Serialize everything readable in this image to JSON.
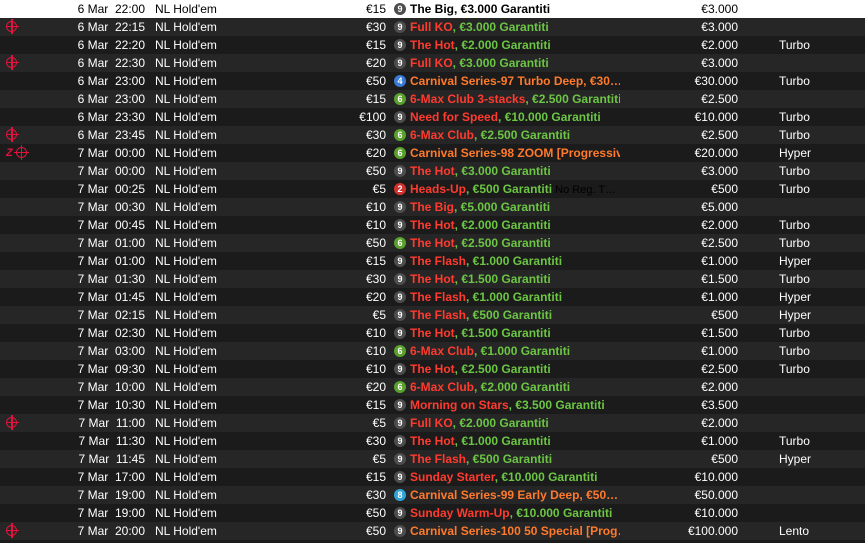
{
  "colors": {
    "name_red": "#ff3b2f",
    "name_green": "#6cc644",
    "name_orange": "#ff7a2c",
    "icon_red": "#e0143c",
    "row_odd": "#262626",
    "row_even": "#1b1b1b",
    "selected_bg": "#ffffff"
  },
  "rows": [
    {
      "icons": [],
      "date": "6 Mar",
      "time": "22:00",
      "game": "NL Hold'em",
      "buyin": "€15",
      "seats": "9",
      "badge_color": "#4d4d4d",
      "name1": "The Big",
      "name2": ", €3.000 Garantiti",
      "note": "",
      "prize": "€3.000",
      "speed": "",
      "selected": true
    },
    {
      "icons": [
        "crosshair-icon"
      ],
      "date": "6 Mar",
      "time": "22:15",
      "game": "NL Hold'em",
      "buyin": "€30",
      "seats": "9",
      "badge_color": "#4d4d4d",
      "name1": "Full KO",
      "name2": ", €3.000 Garantiti",
      "note": "",
      "prize": "€3.000",
      "speed": ""
    },
    {
      "icons": [],
      "date": "6 Mar",
      "time": "22:20",
      "game": "NL Hold'em",
      "buyin": "€15",
      "seats": "9",
      "badge_color": "#4d4d4d",
      "name1": "The Hot",
      "name2": ", €2.000 Garantiti",
      "note": "",
      "prize": "€2.000",
      "speed": "Turbo"
    },
    {
      "icons": [
        "crosshair-icon"
      ],
      "date": "6 Mar",
      "time": "22:30",
      "game": "NL Hold'em",
      "buyin": "€20",
      "seats": "9",
      "badge_color": "#4d4d4d",
      "name1": "Full KO",
      "name2": ", €3.000 Garantiti",
      "note": "",
      "prize": "€3.000",
      "speed": ""
    },
    {
      "icons": [],
      "date": "6 Mar",
      "time": "23:00",
      "game": "NL Hold'em",
      "buyin": "€50",
      "seats": "4",
      "badge_color": "#3a7bd5",
      "name1": "Carnival Series-97 Turbo Deep, €30…",
      "name2": "",
      "orange": true,
      "note": "",
      "prize": "€30.000",
      "speed": "Turbo"
    },
    {
      "icons": [],
      "date": "6 Mar",
      "time": "23:00",
      "game": "NL Hold'em",
      "buyin": "€15",
      "seats": "6",
      "badge_color": "#5aa02c",
      "name1": "6-Max Club 3-stacks",
      "name2": ", €2.500 Garantiti",
      "note": "",
      "prize": "€2.500",
      "speed": ""
    },
    {
      "icons": [],
      "date": "6 Mar",
      "time": "23:30",
      "game": "NL Hold'em",
      "buyin": "€100",
      "seats": "9",
      "badge_color": "#4d4d4d",
      "name1": "Need for Speed",
      "name2": ", €10.000 Garantiti",
      "note": "",
      "prize": "€10.000",
      "speed": "Turbo"
    },
    {
      "icons": [
        "crosshair-icon"
      ],
      "date": "6 Mar",
      "time": "23:45",
      "game": "NL Hold'em",
      "buyin": "€30",
      "seats": "6",
      "badge_color": "#5aa02c",
      "name1": "6-Max Club",
      "name2": ", €2.500 Garantiti",
      "note": "",
      "prize": "€2.500",
      "speed": "Turbo"
    },
    {
      "icons": [
        "zoom-icon",
        "crosshair-icon"
      ],
      "date": "7 Mar",
      "time": "00:00",
      "game": "NL Hold'em",
      "buyin": "€20",
      "seats": "6",
      "badge_color": "#5aa02c",
      "name1": "Carnival Series-98 ZOOM [Progressive…",
      "name2": "",
      "orange": true,
      "note": "",
      "prize": "€20.000",
      "speed": "Hyper"
    },
    {
      "icons": [],
      "date": "7 Mar",
      "time": "00:00",
      "game": "NL Hold'em",
      "buyin": "€50",
      "seats": "9",
      "badge_color": "#4d4d4d",
      "name1": "The Hot",
      "name2": ", €3.000 Garantiti",
      "note": "",
      "prize": "€3.000",
      "speed": "Turbo"
    },
    {
      "icons": [],
      "date": "7 Mar",
      "time": "00:25",
      "game": "NL Hold'em",
      "buyin": "€5",
      "seats": "2",
      "badge_color": "#d0312d",
      "name1": "Heads-Up",
      "name2": ", €500 Garantiti",
      "note": "No Reg. T…",
      "prize": "€500",
      "speed": "Turbo"
    },
    {
      "icons": [],
      "date": "7 Mar",
      "time": "00:30",
      "game": "NL Hold'em",
      "buyin": "€10",
      "seats": "9",
      "badge_color": "#4d4d4d",
      "name1": "The Big",
      "name2": ", €5.000 Garantiti",
      "note": "",
      "prize": "€5.000",
      "speed": ""
    },
    {
      "icons": [],
      "date": "7 Mar",
      "time": "00:45",
      "game": "NL Hold'em",
      "buyin": "€10",
      "seats": "9",
      "badge_color": "#4d4d4d",
      "name1": "The Hot",
      "name2": ", €2.000 Garantiti",
      "note": "",
      "prize": "€2.000",
      "speed": "Turbo"
    },
    {
      "icons": [],
      "date": "7 Mar",
      "time": "01:00",
      "game": "NL Hold'em",
      "buyin": "€50",
      "seats": "6",
      "badge_color": "#5aa02c",
      "name1": "The Hot",
      "name2": ", €2.500 Garantiti",
      "note": "",
      "prize": "€2.500",
      "speed": "Turbo"
    },
    {
      "icons": [],
      "date": "7 Mar",
      "time": "01:00",
      "game": "NL Hold'em",
      "buyin": "€15",
      "seats": "9",
      "badge_color": "#4d4d4d",
      "name1": "The Flash",
      "name2": ", €1.000 Garantiti",
      "note": "",
      "prize": "€1.000",
      "speed": "Hyper"
    },
    {
      "icons": [],
      "date": "7 Mar",
      "time": "01:30",
      "game": "NL Hold'em",
      "buyin": "€30",
      "seats": "9",
      "badge_color": "#4d4d4d",
      "name1": "The Hot",
      "name2": ", €1.500 Garantiti",
      "note": "",
      "prize": "€1.500",
      "speed": "Turbo"
    },
    {
      "icons": [],
      "date": "7 Mar",
      "time": "01:45",
      "game": "NL Hold'em",
      "buyin": "€20",
      "seats": "9",
      "badge_color": "#4d4d4d",
      "name1": "The Flash",
      "name2": ", €1.000 Garantiti",
      "note": "",
      "prize": "€1.000",
      "speed": "Hyper"
    },
    {
      "icons": [],
      "date": "7 Mar",
      "time": "02:15",
      "game": "NL Hold'em",
      "buyin": "€5",
      "seats": "9",
      "badge_color": "#4d4d4d",
      "name1": "The Flash",
      "name2": ", €500 Garantiti",
      "note": "",
      "prize": "€500",
      "speed": "Hyper"
    },
    {
      "icons": [],
      "date": "7 Mar",
      "time": "02:30",
      "game": "NL Hold'em",
      "buyin": "€10",
      "seats": "9",
      "badge_color": "#4d4d4d",
      "name1": "The Hot",
      "name2": ", €1.500 Garantiti",
      "note": "",
      "prize": "€1.500",
      "speed": "Turbo"
    },
    {
      "icons": [],
      "date": "7 Mar",
      "time": "03:00",
      "game": "NL Hold'em",
      "buyin": "€10",
      "seats": "6",
      "badge_color": "#5aa02c",
      "name1": "6-Max Club",
      "name2": ", €1.000 Garantiti",
      "note": "",
      "prize": "€1.000",
      "speed": "Turbo"
    },
    {
      "icons": [],
      "date": "7 Mar",
      "time": "09:30",
      "game": "NL Hold'em",
      "buyin": "€10",
      "seats": "9",
      "badge_color": "#4d4d4d",
      "name1": "The Hot",
      "name2": ", €2.500 Garantiti",
      "note": "",
      "prize": "€2.500",
      "speed": "Turbo"
    },
    {
      "icons": [],
      "date": "7 Mar",
      "time": "10:00",
      "game": "NL Hold'em",
      "buyin": "€20",
      "seats": "6",
      "badge_color": "#5aa02c",
      "name1": "6-Max Club",
      "name2": ", €2.000 Garantiti",
      "note": "",
      "prize": "€2.000",
      "speed": ""
    },
    {
      "icons": [],
      "date": "7 Mar",
      "time": "10:30",
      "game": "NL Hold'em",
      "buyin": "€15",
      "seats": "9",
      "badge_color": "#4d4d4d",
      "name1": "Morning on Stars",
      "name2": ", €3.500 Garantiti",
      "note": "",
      "prize": "€3.500",
      "speed": ""
    },
    {
      "icons": [
        "crosshair-icon"
      ],
      "date": "7 Mar",
      "time": "11:00",
      "game": "NL Hold'em",
      "buyin": "€5",
      "seats": "9",
      "badge_color": "#4d4d4d",
      "name1": "Full KO",
      "name2": ", €2.000 Garantiti",
      "note": "",
      "prize": "€2.000",
      "speed": ""
    },
    {
      "icons": [],
      "date": "7 Mar",
      "time": "11:30",
      "game": "NL Hold'em",
      "buyin": "€30",
      "seats": "9",
      "badge_color": "#4d4d4d",
      "name1": "The Hot",
      "name2": ", €1.000 Garantiti",
      "note": "",
      "prize": "€1.000",
      "speed": "Turbo"
    },
    {
      "icons": [],
      "date": "7 Mar",
      "time": "11:45",
      "game": "NL Hold'em",
      "buyin": "€5",
      "seats": "9",
      "badge_color": "#4d4d4d",
      "name1": "The Flash",
      "name2": ", €500 Garantiti",
      "note": "",
      "prize": "€500",
      "speed": "Hyper"
    },
    {
      "icons": [],
      "date": "7 Mar",
      "time": "17:00",
      "game": "NL Hold'em",
      "buyin": "€15",
      "seats": "9",
      "badge_color": "#4d4d4d",
      "name1": "Sunday Starter",
      "name2": ", €10.000 Garantiti",
      "note": "",
      "prize": "€10.000",
      "speed": ""
    },
    {
      "icons": [],
      "date": "7 Mar",
      "time": "19:00",
      "game": "NL Hold'em",
      "buyin": "€30",
      "seats": "8",
      "badge_color": "#2fa3d6",
      "name1": "Carnival Series-99 Early Deep, €50…",
      "name2": "",
      "orange": true,
      "note": "",
      "prize": "€50.000",
      "speed": ""
    },
    {
      "icons": [],
      "date": "7 Mar",
      "time": "19:00",
      "game": "NL Hold'em",
      "buyin": "€50",
      "seats": "9",
      "badge_color": "#4d4d4d",
      "name1": "Sunday Warm-Up",
      "name2": ", €10.000 Garantiti",
      "note": "",
      "prize": "€10.000",
      "speed": ""
    },
    {
      "icons": [
        "crosshair-icon"
      ],
      "date": "7 Mar",
      "time": "20:00",
      "game": "NL Hold'em",
      "buyin": "€50",
      "seats": "9",
      "badge_color": "#4d4d4d",
      "name1": "Carnival Series-100 50 Special [Prog…",
      "name2": "",
      "orange": true,
      "note": "",
      "prize": "€100.000",
      "speed": "Lento"
    }
  ]
}
